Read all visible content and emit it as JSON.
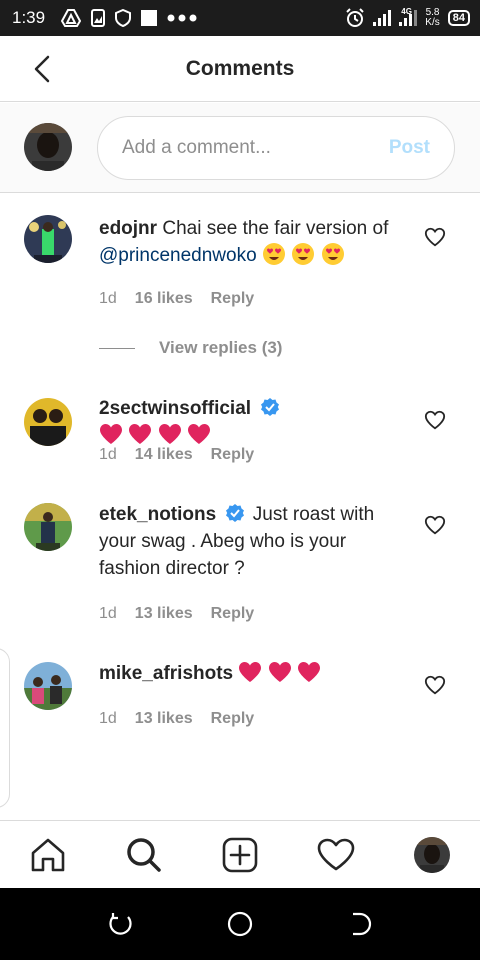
{
  "status_bar": {
    "time": "1:39",
    "network_type": "4G",
    "net_speed_value": "5.8",
    "net_speed_unit": "K/s",
    "battery": "84"
  },
  "header": {
    "title": "Comments",
    "back_icon": "chevron-left-icon"
  },
  "composer": {
    "placeholder": "Add a comment...",
    "value": "",
    "post_label": "Post",
    "post_color": "#b2dffc"
  },
  "comments": [
    {
      "username": "edojnr",
      "text": "Chai see the fair version of",
      "mention": "@princenednwoko",
      "emojis": [
        "heart-eyes",
        "heart-eyes",
        "heart-eyes"
      ],
      "verified": false,
      "time": "1d",
      "likes": "16 likes",
      "reply_label": "Reply",
      "view_replies": "View replies (3)"
    },
    {
      "username": "2sectwinsofficial",
      "text": "",
      "emojis": [
        "red-heart",
        "red-heart",
        "red-heart",
        "red-heart"
      ],
      "verified": true,
      "time": "1d",
      "likes": "14 likes",
      "reply_label": "Reply"
    },
    {
      "username": "etek_notions",
      "text": "Just roast with your swag . Abeg who is your fashion director ?",
      "emojis": [],
      "verified": true,
      "time": "1d",
      "likes": "13 likes",
      "reply_label": "Reply"
    },
    {
      "username": "mike_afrishots",
      "text": "",
      "emojis": [
        "red-heart",
        "red-heart",
        "red-heart"
      ],
      "verified": false,
      "time": "1d",
      "likes": "13 likes",
      "reply_label": "Reply"
    }
  ],
  "bottom_nav": [
    "home-icon",
    "search-icon",
    "add-post-icon",
    "activity-heart-icon",
    "profile-avatar"
  ],
  "colors": {
    "mention": "#003569",
    "secondary_text": "#8e8e8e",
    "verified": "#3897f0",
    "heart_emoji": "#e0245e",
    "divider": "#dbdbdb"
  }
}
